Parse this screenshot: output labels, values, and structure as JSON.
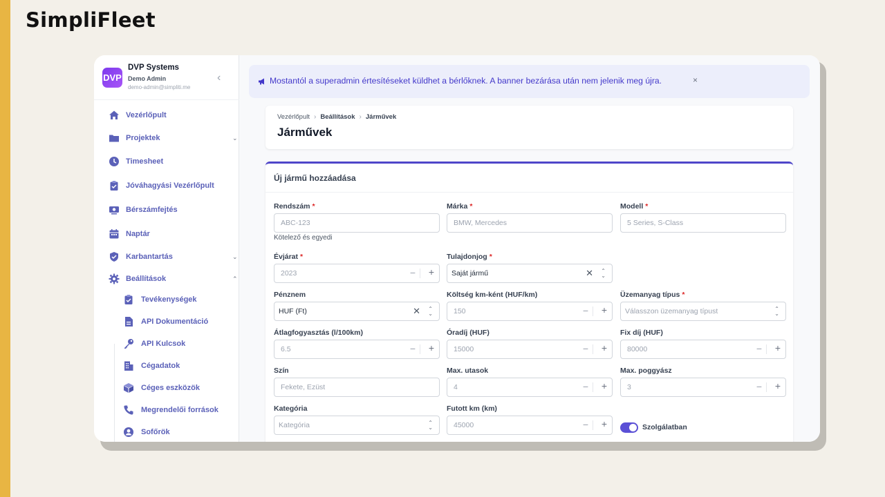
{
  "brand": {
    "title": "SimpliFleet"
  },
  "org": {
    "logo": "DVP",
    "name": "DVP Systems",
    "role": "Demo Admin",
    "email": "demo-admin@simpliti.me",
    "collapse_icon": "chevron-left-icon"
  },
  "colors": {
    "accent": "#4f46c9",
    "nav_text": "#5b61b8",
    "stripe": "#e8b543",
    "banner_bg": "#eceefb",
    "required": "#dc2626"
  },
  "sidebar": {
    "items": [
      {
        "label": "Vezérlőpult",
        "icon": "home-icon"
      },
      {
        "label": "Projektek",
        "icon": "folder-icon",
        "expandable": true
      },
      {
        "label": "Timesheet",
        "icon": "clock-icon"
      },
      {
        "label": "Jóváhagyási Vezérlőpult",
        "icon": "clipboard-check-icon"
      },
      {
        "label": "Bérszámfejtés",
        "icon": "payroll-icon"
      },
      {
        "label": "Naptár",
        "icon": "calendar-icon"
      },
      {
        "label": "Karbantartás",
        "icon": "shield-icon",
        "expandable": true
      },
      {
        "label": "Beállítások",
        "icon": "gear-icon",
        "expanded": true
      }
    ],
    "subitems": [
      {
        "label": "Tevékenységek",
        "icon": "clipboard-icon"
      },
      {
        "label": "API Dokumentáció",
        "icon": "document-icon"
      },
      {
        "label": "API Kulcsok",
        "icon": "key-icon"
      },
      {
        "label": "Cégadatok",
        "icon": "building-icon"
      },
      {
        "label": "Céges eszközök",
        "icon": "cube-icon"
      },
      {
        "label": "Megrendelői források",
        "icon": "phone-icon"
      },
      {
        "label": "Sofőrök",
        "icon": "user-circle-icon"
      }
    ]
  },
  "banner": {
    "icon": "megaphone-icon",
    "text": "Mostantól a superadmin értesítéseket küldhet a bérlőknek. A banner bezárása után nem jelenik meg újra.",
    "close": "×"
  },
  "breadcrumb": [
    "Vezérlőpult",
    "Beállítások",
    "Járművek"
  ],
  "page": {
    "title": "Járművek"
  },
  "form": {
    "title": "Új jármű hozzáadása",
    "fields": {
      "plate": {
        "label": "Rendszám",
        "required": true,
        "placeholder": "ABC-123",
        "hint": "Kötelező és egyedi"
      },
      "make": {
        "label": "Márka",
        "required": true,
        "placeholder": "BMW, Mercedes"
      },
      "model": {
        "label": "Modell",
        "required": true,
        "placeholder": "5 Series, S-Class"
      },
      "year": {
        "label": "Évjárat",
        "required": true,
        "placeholder": "2023"
      },
      "ownership": {
        "label": "Tulajdonjog",
        "required": true,
        "value": "Saját jármű"
      },
      "currency": {
        "label": "Pénznem",
        "value": "HUF (Ft)"
      },
      "cost_per_km": {
        "label": "Költség km-ként (HUF/km)",
        "placeholder": "150"
      },
      "fuel_type": {
        "label": "Üzemanyag típus",
        "required": true,
        "placeholder": "Válasszon üzemanyag típust"
      },
      "consumption": {
        "label": "Átlagfogyasztás (l/100km)",
        "placeholder": "6.5"
      },
      "hourly_rate": {
        "label": "Óradíj (HUF)",
        "placeholder": "15000"
      },
      "fixed_fee": {
        "label": "Fix díj (HUF)",
        "placeholder": "80000"
      },
      "color": {
        "label": "Szín",
        "placeholder": "Fekete, Ezüst"
      },
      "max_passengers": {
        "label": "Max. utasok",
        "placeholder": "4"
      },
      "max_luggage": {
        "label": "Max. poggyász",
        "placeholder": "3"
      },
      "category": {
        "label": "Kategória",
        "placeholder": "Kategória"
      },
      "mileage": {
        "label": "Futott km (km)",
        "placeholder": "45000"
      },
      "in_service": {
        "label": "Szolgálatban",
        "checked": true
      }
    }
  }
}
